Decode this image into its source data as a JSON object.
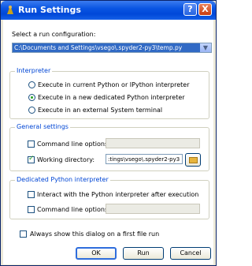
{
  "window": {
    "title": "Run Settings",
    "help_label": "?",
    "close_label": "X"
  },
  "run_configuration": {
    "label": "Select a run configuration:",
    "selected": "C:\\Documents and Settings\\vsego\\.spyder2-py3\\temp.py",
    "dropdown_arrow": "▼"
  },
  "interpreter": {
    "title": "Interpreter",
    "options": [
      {
        "label": "Execute in current Python or IPython interpreter",
        "selected": false
      },
      {
        "label": "Execute in a new dedicated Python interpreter",
        "selected": true
      },
      {
        "label": "Execute in an external System terminal",
        "selected": false
      }
    ]
  },
  "general_settings": {
    "title": "General settings",
    "command_line_label": "Command line options:",
    "command_line_checked": false,
    "command_line_value": "",
    "working_dir_label": "Working directory:",
    "working_dir_checked": true,
    "working_dir_value": ":tings\\vsego\\.spyder2-py3",
    "browse_icon": "folder-icon"
  },
  "dedicated_interpreter": {
    "title": "Dedicated Python interpreter",
    "interact_label": "Interact with the Python interpreter after execution",
    "interact_checked": false,
    "command_line_label": "Command line options:",
    "command_line_checked": false,
    "command_line_value": ""
  },
  "always_show": {
    "label": "Always show this dialog on a first file run",
    "checked": false
  },
  "buttons": {
    "ok": "OK",
    "run": "Run",
    "cancel": "Cancel"
  }
}
